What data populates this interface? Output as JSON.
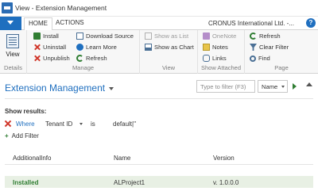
{
  "window": {
    "title": "View - Extension Management"
  },
  "ribbon_tabs": {
    "home": "HOME",
    "actions": "ACTIONS"
  },
  "company": "CRONUS International Ltd. -...",
  "help": "?",
  "ribbon": {
    "details": {
      "label": "Details",
      "view": "View"
    },
    "manage": {
      "label": "Manage",
      "install": "Install",
      "uninstall": "Uninstall",
      "unpublish": "Unpublish",
      "download_source": "Download Source",
      "learn_more": "Learn More",
      "refresh": "Refresh"
    },
    "view_group": {
      "label": "View",
      "show_as_list": "Show as List",
      "show_as_chart": "Show as Chart"
    },
    "show_attached": {
      "label": "Show Attached",
      "onenote": "OneNote",
      "notes": "Notes",
      "links": "Links"
    },
    "page": {
      "label": "Page",
      "refresh": "Refresh",
      "clear_filter": "Clear Filter",
      "find": "Find"
    }
  },
  "page_title": "Extension Management",
  "search": {
    "placeholder": "Type to filter (F3)",
    "field": "Name"
  },
  "filters": {
    "heading": "Show results:",
    "row": {
      "where": "Where",
      "field": "Tenant ID",
      "operator": "is",
      "value": "default|''"
    },
    "add_filter": "Add Filter"
  },
  "table": {
    "columns": [
      "AdditionalInfo",
      "Name",
      "Version"
    ],
    "rows": [
      {
        "additional_info": "Installed",
        "name": "ALProject1",
        "version": "v. 1.0.0.0"
      }
    ]
  },
  "colors": {
    "accent": "#1f6fbf",
    "installed": "#2f7d32",
    "remove": "#d0362a"
  }
}
